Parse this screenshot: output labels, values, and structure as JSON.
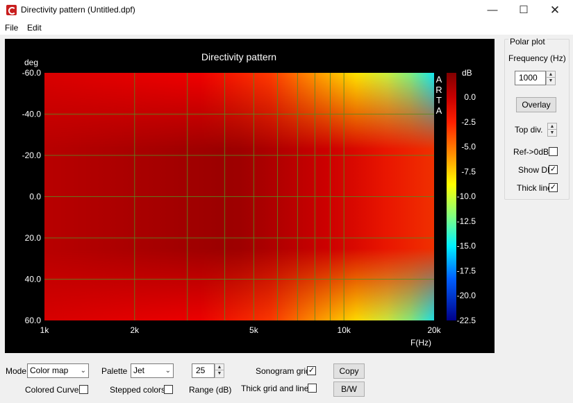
{
  "window": {
    "title": "Directivity pattern (Untitled.dpf)"
  },
  "menu": {
    "file": "File",
    "edit": "Edit"
  },
  "chart": {
    "title": "Directivity pattern",
    "y_unit": "deg",
    "x_unit": "F(Hz)",
    "y_ticks": [
      "-60.0",
      "-40.0",
      "-20.0",
      "0.0",
      "20.0",
      "40.0",
      "60.0"
    ],
    "x_ticks": [
      "1k",
      "2k",
      "5k",
      "10k",
      "20k"
    ],
    "watermark": [
      "A",
      "R",
      "T",
      "A"
    ],
    "colorbar_unit": "dB",
    "colorbar_ticks": [
      "0.0",
      "-2.5",
      "-5.0",
      "-7.5",
      "-10.0",
      "-12.5",
      "-15.0",
      "-17.5",
      "-20.0",
      "-22.5"
    ]
  },
  "chart_data": {
    "type": "heatmap",
    "title": "Directivity pattern",
    "xlabel": "F(Hz)",
    "ylabel": "deg",
    "x_scale": "log",
    "xlim": [
      1000,
      20000
    ],
    "ylim": [
      -60,
      60
    ],
    "x_ticks": [
      1000,
      2000,
      5000,
      10000,
      20000
    ],
    "y_ticks": [
      -60,
      -40,
      -20,
      0,
      20,
      40,
      60
    ],
    "colorbar": {
      "unit": "dB",
      "range": [
        -22.5,
        2.5
      ],
      "palette": "Jet"
    },
    "frequencies_hz": [
      1000,
      2000,
      3000,
      5000,
      7000,
      10000,
      12000,
      15000,
      20000
    ],
    "angles_deg": [
      -60,
      -45,
      -30,
      -15,
      0,
      15,
      30,
      45,
      60
    ],
    "values_db": [
      [
        -1.0,
        -1.5,
        -2.0,
        -3.0,
        -4.5,
        -6.5,
        -8.5,
        -10.5,
        -12.5
      ],
      [
        -0.8,
        -1.0,
        -1.5,
        -2.0,
        -3.0,
        -4.5,
        -5.5,
        -6.5,
        -8.0
      ],
      [
        -0.3,
        -0.5,
        -0.8,
        -1.0,
        -1.5,
        -2.3,
        -3.0,
        -3.5,
        -4.5
      ],
      [
        0.2,
        0.3,
        0.3,
        0.3,
        0.0,
        -0.5,
        -1.0,
        -1.5,
        -2.0
      ],
      [
        0.5,
        0.6,
        0.7,
        0.7,
        0.6,
        0.5,
        0.2,
        -0.5,
        -1.0
      ],
      [
        0.2,
        0.3,
        0.3,
        0.3,
        0.0,
        -0.5,
        -1.0,
        -1.5,
        -2.0
      ],
      [
        -0.3,
        -0.5,
        -0.8,
        -1.0,
        -1.5,
        -2.3,
        -3.0,
        -3.5,
        -4.5
      ],
      [
        -0.8,
        -1.0,
        -1.5,
        -2.0,
        -3.0,
        -4.5,
        -5.5,
        -6.5,
        -8.0
      ],
      [
        -1.0,
        -1.5,
        -2.0,
        -3.0,
        -4.5,
        -6.5,
        -8.5,
        -10.5,
        -12.5
      ]
    ]
  },
  "polar": {
    "group_title": "Polar plot",
    "frequency_label": "Frequency (Hz)",
    "frequency_value": "1000",
    "overlay_label": "Overlay",
    "top_div_label": "Top div.",
    "ref_label": "Ref->0dB",
    "ref_checked": false,
    "show_di_label": "Show DI",
    "show_di_checked": true,
    "thick_line_label": "Thick line",
    "thick_line_checked": true
  },
  "bottom": {
    "mode_label": "Mode",
    "mode_value": "Color map",
    "palette_label": "Palette",
    "palette_value": "Jet",
    "range_value": "25",
    "range_label": "Range (dB)",
    "sonogram_grid_label": "Sonogram grid",
    "sonogram_grid_checked": true,
    "copy_label": "Copy",
    "colored_curves_label": "Colored Curves",
    "colored_curves_checked": false,
    "stepped_colors_label": "Stepped colors",
    "stepped_colors_checked": false,
    "thick_grid_label": "Thick grid and  lines",
    "thick_grid_checked": false,
    "bw_label": "B/W"
  },
  "icons": {
    "app": "arta-app-icon",
    "minimize": "minimize-icon",
    "maximize": "maximize-icon",
    "close": "close-icon",
    "checkmark": "checkmark-icon",
    "caret": "chevron-down-icon",
    "spin_up": "spin-up-icon",
    "spin_down": "spin-down-icon"
  }
}
